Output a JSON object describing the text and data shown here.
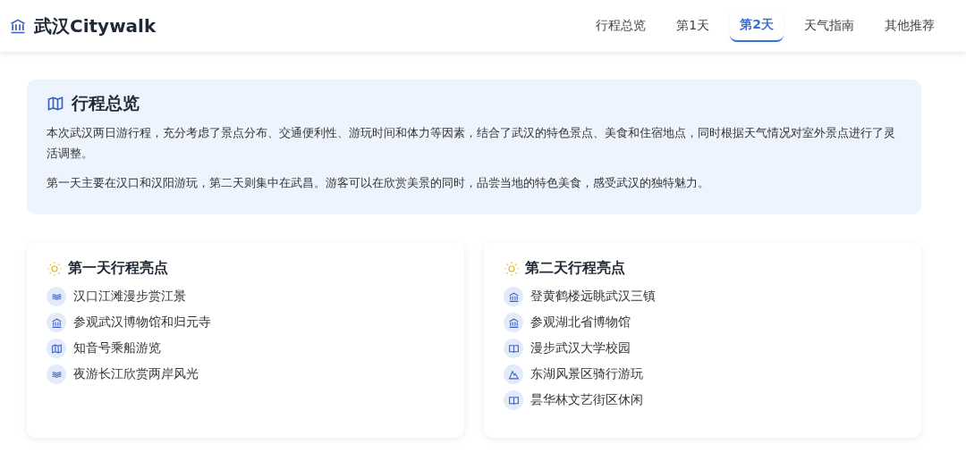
{
  "brand": {
    "title": "武汉Citywalk"
  },
  "nav": [
    {
      "label": "行程总览",
      "selected": false
    },
    {
      "label": "第1天",
      "selected": false
    },
    {
      "label": "第2天",
      "selected": true
    },
    {
      "label": "天气指南",
      "selected": false
    },
    {
      "label": "其他推荐",
      "selected": false
    }
  ],
  "overview": {
    "title": "行程总览",
    "paragraphs": [
      "本次武汉两日游行程，充分考虑了景点分布、交通便利性、游玩时间和体力等因素，结合了武汉的特色景点、美食和住宿地点，同时根据天气情况对室外景点进行了灵活调整。",
      "第一天主要在汉口和汉阳游玩，第二天则集中在武昌。游客可以在欣赏美景的同时，品尝当地的特色美食，感受武汉的独特魅力。"
    ]
  },
  "highlights": [
    {
      "title": "第一天行程亮点",
      "items": [
        {
          "kind": "waves",
          "text": "汉口江滩漫步赏江景"
        },
        {
          "kind": "museum",
          "text": "参观武汉博物馆和归元寺"
        },
        {
          "kind": "map",
          "text": "知音号乘船游览"
        },
        {
          "kind": "waves",
          "text": "夜游长江欣赏两岸风光"
        }
      ]
    },
    {
      "title": "第二天行程亮点",
      "items": [
        {
          "kind": "museum",
          "text": "登黄鹤楼远眺武汉三镇"
        },
        {
          "kind": "museum",
          "text": "参观湖北省博物馆"
        },
        {
          "kind": "book",
          "text": "漫步武汉大学校园"
        },
        {
          "kind": "mountain",
          "text": "东湖风景区骑行游玩"
        },
        {
          "kind": "book",
          "text": "昙华林文艺街区休闲"
        }
      ]
    }
  ]
}
